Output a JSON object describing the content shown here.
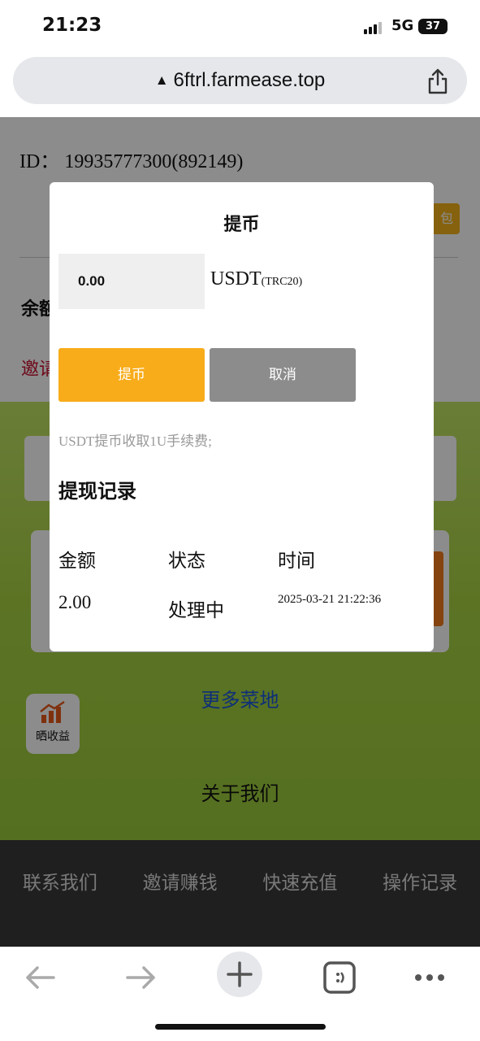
{
  "status_bar": {
    "time": "21:23",
    "network": "5G",
    "battery": "37"
  },
  "browser": {
    "url": "6ftrl.farmease.top"
  },
  "page": {
    "user_id": "ID：  19935777300(892149)",
    "orange_button_label": "包",
    "balance_label": "余额",
    "invite_label": "邀请",
    "share_earnings_label": "晒收益",
    "more_farms_link": "更多菜地",
    "about_us_link": "关于我们",
    "footer_nav": [
      "联系我们",
      "邀请赚钱",
      "快速充值",
      "操作记录"
    ]
  },
  "withdraw_modal": {
    "title": "提币",
    "amount_value": "0.00",
    "currency": "USDT",
    "network": "(TRC20)",
    "submit_label": "提币",
    "cancel_label": "取消",
    "fee_note": "USDT提币收取1U手续费;",
    "records_title": "提现记录",
    "table_headers": [
      "金额",
      "状态",
      "时间"
    ],
    "records": [
      {
        "amount": "2.00",
        "status": "处理中",
        "time": "2025-03-21 21:22:36"
      }
    ]
  },
  "colors": {
    "accent": "#f8ac1a",
    "cancel": "#8c8c8c",
    "link": "#1a56db",
    "progress": "#1d6fe3"
  }
}
